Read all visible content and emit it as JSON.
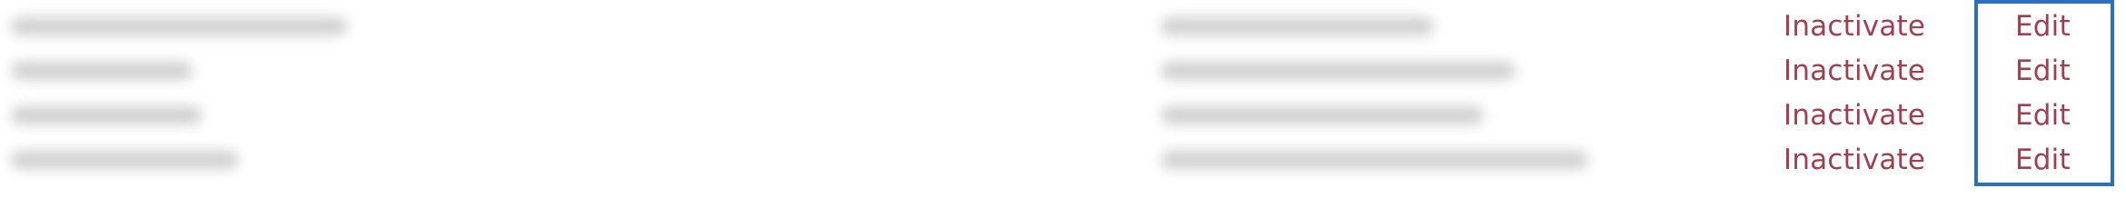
{
  "users_table": {
    "rows": [
      {
        "name": "",
        "email": "",
        "inactivate_label": "Inactivate",
        "edit_label": "Edit"
      },
      {
        "name": "",
        "email": "",
        "inactivate_label": "Inactivate",
        "edit_label": "Edit"
      },
      {
        "name": "",
        "email": "",
        "inactivate_label": "Inactivate",
        "edit_label": "Edit"
      },
      {
        "name": "",
        "email": "",
        "inactivate_label": "Inactivate",
        "edit_label": "Edit"
      }
    ]
  },
  "colors": {
    "action_link": "#a0404f",
    "highlight_border": "#2f6fb8",
    "redacted_text": "#c8c8c8"
  }
}
